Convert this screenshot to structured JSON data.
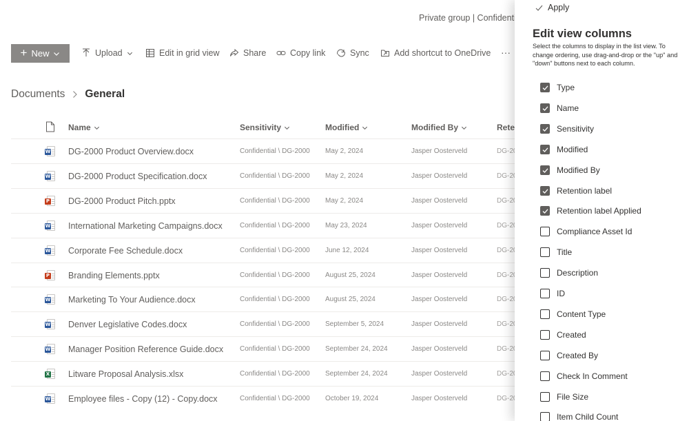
{
  "header": {
    "group_info": "Private group | Confidentia"
  },
  "toolbar": {
    "new_label": "New",
    "upload_label": "Upload",
    "edit_grid_label": "Edit in grid view",
    "share_label": "Share",
    "copy_link_label": "Copy link",
    "sync_label": "Sync",
    "add_shortcut_label": "Add shortcut to OneDrive",
    "more_label": "···"
  },
  "breadcrumb": {
    "parent": "Documents",
    "current": "General"
  },
  "columns": {
    "name": "Name",
    "sensitivity": "Sensitivity",
    "modified": "Modified",
    "modified_by": "Modified By",
    "retention": "Rete"
  },
  "files": [
    {
      "type": "docx",
      "name": "DG-2000 Product Overview.docx",
      "sensitivity": "Confidential \\ DG-2000",
      "modified": "May 2, 2024",
      "modified_by": "Jasper Oosterveld",
      "retention": "DG-20"
    },
    {
      "type": "docx",
      "name": "DG-2000 Product Specification.docx",
      "sensitivity": "Confidential \\ DG-2000",
      "modified": "May 2, 2024",
      "modified_by": "Jasper Oosterveld",
      "retention": "DG-20"
    },
    {
      "type": "pptx",
      "name": "DG-2000 Product Pitch.pptx",
      "sensitivity": "Confidential \\ DG-2000",
      "modified": "May 2, 2024",
      "modified_by": "Jasper Oosterveld",
      "retention": "DG-20"
    },
    {
      "type": "docx",
      "name": "International Marketing Campaigns.docx",
      "sensitivity": "Confidential \\ DG-2000",
      "modified": "May 23, 2024",
      "modified_by": "Jasper Oosterveld",
      "retention": "DG-20"
    },
    {
      "type": "docx",
      "name": "Corporate Fee Schedule.docx",
      "sensitivity": "Confidential \\ DG-2000",
      "modified": "June 12, 2024",
      "modified_by": "Jasper Oosterveld",
      "retention": "DG-20"
    },
    {
      "type": "pptx",
      "name": "Branding Elements.pptx",
      "sensitivity": "Confidential \\ DG-2000",
      "modified": "August 25, 2024",
      "modified_by": "Jasper Oosterveld",
      "retention": "DG-20"
    },
    {
      "type": "docx",
      "name": "Marketing To Your Audience.docx",
      "sensitivity": "Confidential \\ DG-2000",
      "modified": "August 25, 2024",
      "modified_by": "Jasper Oosterveld",
      "retention": "DG-20"
    },
    {
      "type": "docx",
      "name": "Denver Legislative Codes.docx",
      "sensitivity": "Confidential \\ DG-2000",
      "modified": "September 5, 2024",
      "modified_by": "Jasper Oosterveld",
      "retention": "DG-20"
    },
    {
      "type": "docx",
      "name": "Manager Position Reference Guide.docx",
      "sensitivity": "Confidential \\ DG-2000",
      "modified": "September 24, 2024",
      "modified_by": "Jasper Oosterveld",
      "retention": "DG-20"
    },
    {
      "type": "xlsx",
      "name": "Litware Proposal Analysis.xlsx",
      "sensitivity": "Confidential \\ DG-2000",
      "modified": "September 24, 2024",
      "modified_by": "Jasper Oosterveld",
      "retention": "DG-20"
    },
    {
      "type": "docx",
      "name": "Employee files - Copy (12) - Copy.docx",
      "sensitivity": "Confidential \\ DG-2000",
      "modified": "October 19, 2024",
      "modified_by": "Jasper Oosterveld",
      "retention": "DG-20"
    }
  ],
  "panel": {
    "apply_label": "Apply",
    "title": "Edit view columns",
    "description": "Select the columns to display in the list view. To change ordering, use drag-and-drop or the \"up\" and \"down\" buttons next to each column.",
    "options": [
      {
        "label": "Type",
        "checked": true
      },
      {
        "label": "Name",
        "checked": true
      },
      {
        "label": "Sensitivity",
        "checked": true
      },
      {
        "label": "Modified",
        "checked": true
      },
      {
        "label": "Modified By",
        "checked": true
      },
      {
        "label": "Retention label",
        "checked": true
      },
      {
        "label": "Retention label Applied",
        "checked": true
      },
      {
        "label": "Compliance Asset Id",
        "checked": false
      },
      {
        "label": "Title",
        "checked": false
      },
      {
        "label": "Description",
        "checked": false
      },
      {
        "label": "ID",
        "checked": false
      },
      {
        "label": "Content Type",
        "checked": false
      },
      {
        "label": "Created",
        "checked": false
      },
      {
        "label": "Created By",
        "checked": false
      },
      {
        "label": "Check In Comment",
        "checked": false
      },
      {
        "label": "File Size",
        "checked": false
      },
      {
        "label": "Item Child Count",
        "checked": false
      }
    ]
  },
  "colors": {
    "docx": "#2b579a",
    "pptx": "#c43e1c",
    "xlsx": "#217346",
    "new_button": "#8a8886",
    "checkbox_checked": "#605e5c"
  }
}
